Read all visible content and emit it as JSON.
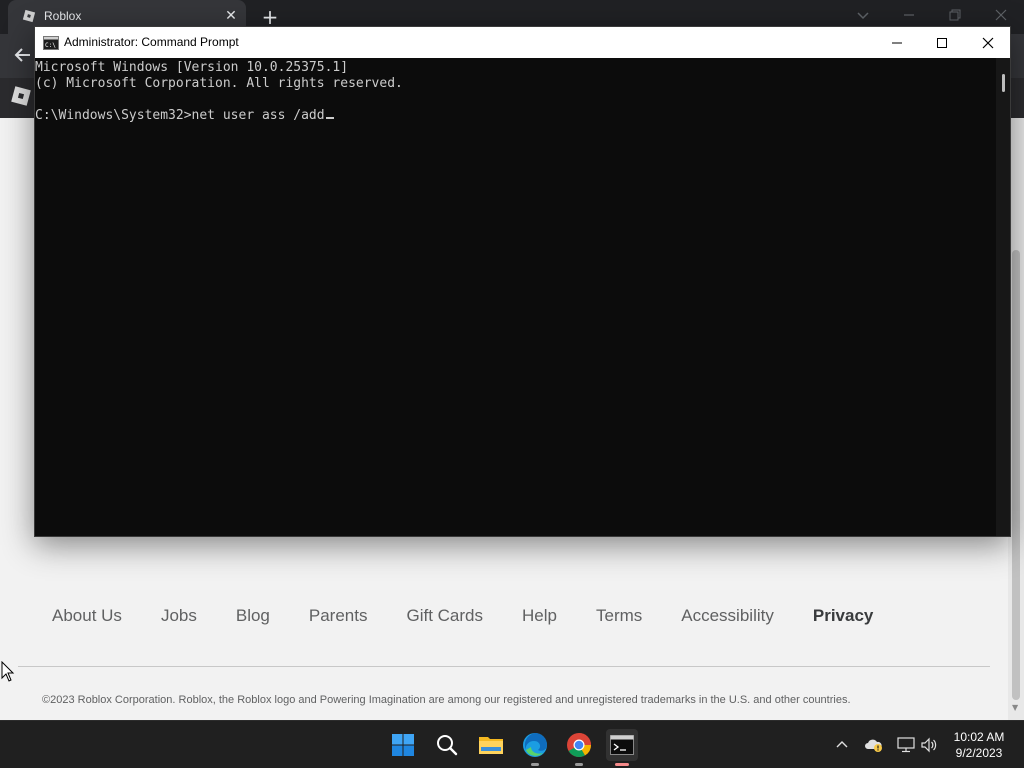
{
  "browser": {
    "tab_title": "Roblox",
    "tab_close": "✕",
    "new_tab": "+"
  },
  "footer": {
    "links": [
      "About Us",
      "Jobs",
      "Blog",
      "Parents",
      "Gift Cards",
      "Help",
      "Terms",
      "Accessibility",
      "Privacy"
    ],
    "copyright": "©2023 Roblox Corporation. Roblox, the Roblox logo and Powering Imagination are among our registered and unregistered trademarks in the U.S. and other countries."
  },
  "cmd": {
    "title": "Administrator: Command Prompt",
    "lines": [
      "Microsoft Windows [Version 10.0.25375.1]",
      "(c) Microsoft Corporation. All rights reserved.",
      "",
      "C:\\Windows\\System32>net user ass /add"
    ]
  },
  "taskbar": {
    "clock_time": "10:02 AM",
    "clock_date": "9/2/2023"
  },
  "colors": {
    "cmd_background": "#0c0c0c",
    "cmd_text": "#cccccc",
    "taskbar": "#202020",
    "windows_blue": "#0078d4"
  }
}
